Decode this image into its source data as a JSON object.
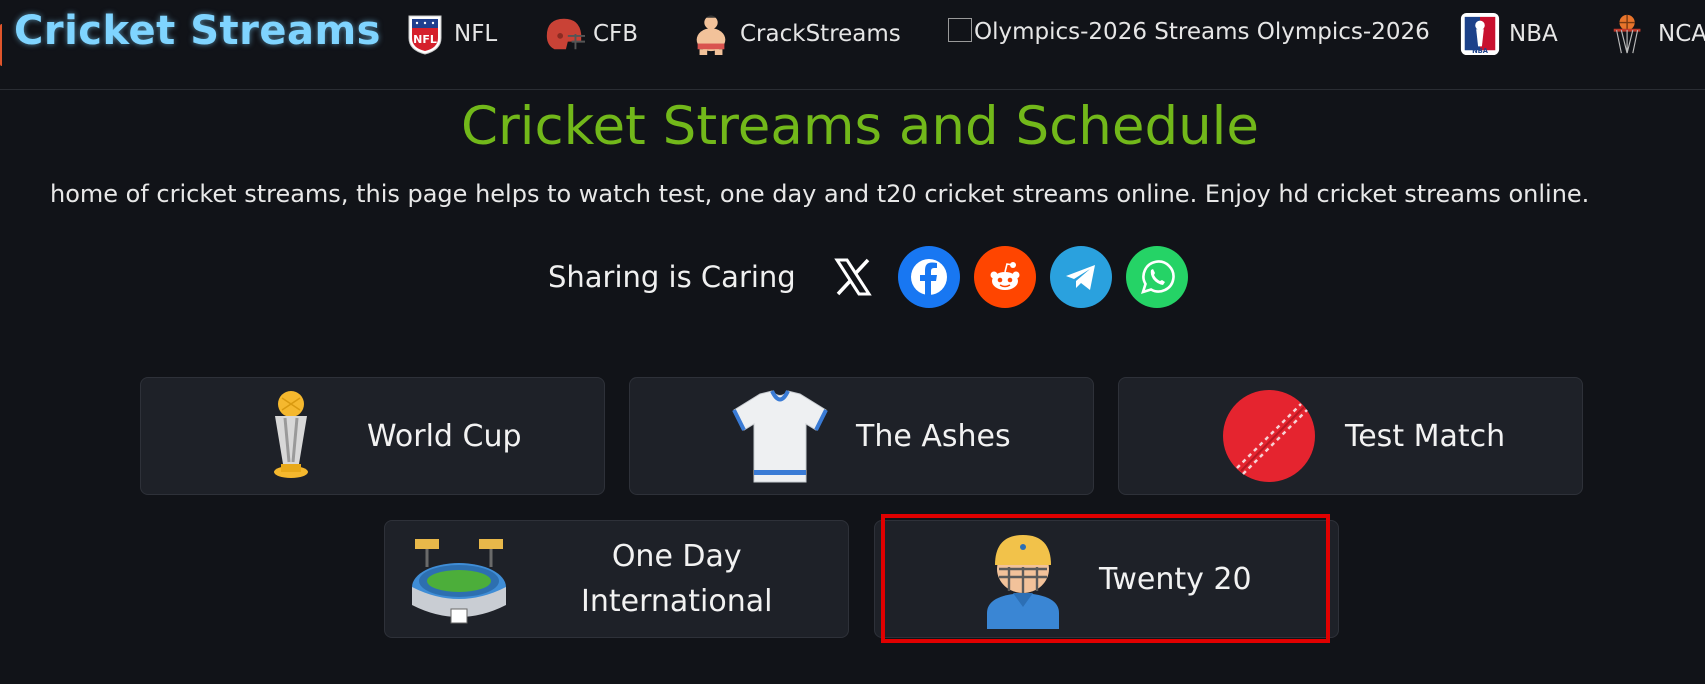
{
  "header": {
    "brand": "Cricket Streams",
    "nav": [
      {
        "label": "NFL",
        "icon": "nfl-logo-icon"
      },
      {
        "label": "CFB",
        "icon": "football-helmet-icon"
      },
      {
        "label": "CrackStreams",
        "icon": "sumo-wrestler-icon"
      },
      {
        "label": "Olympics-2026 Streams Olympics-2026",
        "icon": "broken-image-icon"
      },
      {
        "label": "NBA",
        "icon": "nba-logo-icon"
      },
      {
        "label": "NCA",
        "icon": "basketball-hoop-icon"
      }
    ]
  },
  "main": {
    "title": "Cricket Streams and Schedule",
    "subtitle": "home of cricket streams, this page helps to watch test, one day and t20 cricket streams online. Enjoy hd cricket streams online.",
    "share": {
      "label": "Sharing is Caring",
      "buttons": [
        "x-icon",
        "facebook-icon",
        "reddit-icon",
        "telegram-icon",
        "whatsapp-icon"
      ]
    },
    "categories": [
      {
        "label": "World Cup",
        "icon": "trophy-icon"
      },
      {
        "label": "The Ashes",
        "icon": "jersey-icon"
      },
      {
        "label": "Test Match",
        "icon": "cricket-ball-icon"
      },
      {
        "label_line1": "One Day",
        "label_line2": "International",
        "icon": "stadium-icon"
      },
      {
        "label": "Twenty 20",
        "icon": "cricket-batsman-icon",
        "highlighted": true
      }
    ]
  },
  "colors": {
    "background": "#111318",
    "brand": "#7fd4ff",
    "title": "#72b81a",
    "card": "#1e2128",
    "highlight": "#e00000"
  }
}
